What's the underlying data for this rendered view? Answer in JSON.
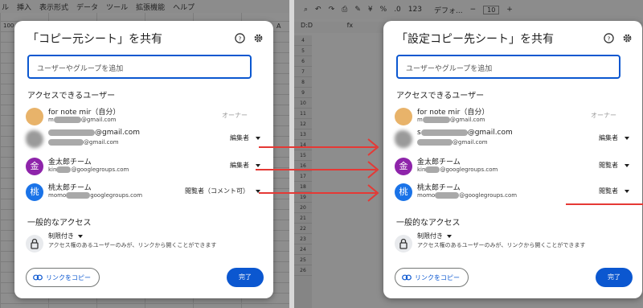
{
  "left_sheet": {
    "menu": [
      "ル",
      "挿入",
      "表示形式",
      "データ",
      "ツール",
      "拡張機能",
      "ヘルプ"
    ],
    "zoom": "100",
    "colA": "A"
  },
  "right_sheet": {
    "fontname": "デフォ...",
    "fontsize": "10",
    "zoom_hint": "123",
    "cellref": "D:D",
    "fx": "fx",
    "rows": [
      "4",
      "5",
      "6",
      "7",
      "8",
      "9",
      "10",
      "11",
      "12",
      "13",
      "14",
      "15",
      "16",
      "17",
      "18",
      "19",
      "20",
      "21",
      "22",
      "23",
      "24",
      "25",
      "26"
    ]
  },
  "dialog_left": {
    "title": "「コピー元シート」を共有",
    "search_placeholder": "ユーザーやグループを追加",
    "people_heading": "アクセスできるユーザー",
    "owner": {
      "name": "for note mir（自分）",
      "email_suffix": "@gmail.com",
      "role": "オーナー"
    },
    "user2": {
      "name_suffix": "@gmail.com",
      "email_suffix": "@gmail.com",
      "role": "編集者"
    },
    "user3": {
      "name": "金太郎チーム",
      "avatar": "金",
      "email_prefix": "kin",
      "email_suffix": "@googlegroups.com",
      "role": "編集者"
    },
    "user4": {
      "name": "桃太郎チーム",
      "avatar": "桃",
      "email_prefix": "momo",
      "email_suffix": "googlegroups.com",
      "role": "閲覧者（コメント可）"
    },
    "general_heading": "一般的なアクセス",
    "restricted": "制限付き",
    "restricted_desc": "アクセス権のあるユーザーのみが、リンクから開くことができます",
    "copy_link": "リンクをコピー",
    "done": "完了"
  },
  "dialog_right": {
    "title": "「設定コピー先シート」を共有",
    "search_placeholder": "ユーザーやグループを追加",
    "people_heading": "アクセスできるユーザー",
    "owner": {
      "name": "for note mir（自分）",
      "email_suffix": "@gmail.com",
      "role": "オーナー"
    },
    "user2": {
      "name_prefix": "s",
      "name_suffix": "@gmail.com",
      "email_suffix": "@gmail.com",
      "role": "編集者"
    },
    "user3": {
      "name": "金太郎チーム",
      "avatar": "金",
      "email_prefix": "kin",
      "email_suffix": "@googlegroups.com",
      "role": "閲覧者"
    },
    "user4": {
      "name": "桃太郎チーム",
      "avatar": "桃",
      "email_prefix": "momo",
      "email_suffix": "@googlegroups.com",
      "role": "閲覧者"
    },
    "general_heading": "一般的なアクセス",
    "restricted": "制限付き",
    "restricted_desc": "アクセス権のあるユーザーのみが、リンクから開くことができます",
    "copy_link": "リンクをコピー",
    "done": "完了"
  },
  "colors": {
    "arrow": "#e53935",
    "primary": "#0b57d0"
  },
  "icons": [
    "help-icon",
    "gear-icon",
    "lock-icon",
    "link-icon",
    "caret-down-icon"
  ]
}
